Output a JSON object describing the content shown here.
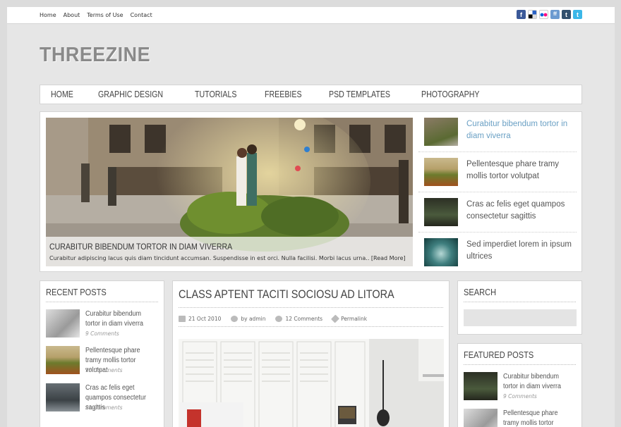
{
  "topbar": {
    "links": [
      "Home",
      "About",
      "Terms of Use",
      "Contact"
    ],
    "social_icons": [
      {
        "name": "facebook-icon",
        "color": "#3b5998",
        "glyph": "f"
      },
      {
        "name": "delicious-icon",
        "color": "#2a62c5",
        "glyph": ""
      },
      {
        "name": "flickr-icon",
        "color": "#ffffff",
        "glyph": ""
      },
      {
        "name": "friendfeed-icon",
        "color": "#6b9ad0",
        "glyph": "ff"
      },
      {
        "name": "tumblr-icon",
        "color": "#32506d",
        "glyph": "t"
      },
      {
        "name": "twitter-icon",
        "color": "#3bb7e8",
        "glyph": "t"
      }
    ]
  },
  "logo": "THREEZINE",
  "nav": [
    "HOME",
    "GRAPHIC DESIGN",
    "TUTORIALS",
    "FREEBIES",
    "PSD TEMPLATES",
    "PHOTOGRAPHY"
  ],
  "slider": {
    "caption_title": "CURABITUR BIBENDUM TORTOR IN DIAM VIVERRA",
    "caption_text": "Curabitur adipiscing lacus quis diam tincidunt accumsan. Suspendisse in est orci. Nulla facilisi. Morbi lacus urna.. [Read More]",
    "thumbs": [
      "Curabitur bibendum tortor in diam viverra",
      "Pellentesque phare tramy mollis tortor volutpat",
      "Cras ac felis eget quampos consectetur sagittis",
      "Sed imperdiet lorem in ipsum ultrices"
    ]
  },
  "recent_posts": {
    "title": "RECENT POSTS",
    "items": [
      {
        "title": "Curabitur bibendum tortor in diam viverra",
        "comments": "9 Comments"
      },
      {
        "title": "Pellentesque phare tramy mollis tortor volutpat",
        "comments": "13 Comments"
      },
      {
        "title": "Cras ac felis eget quampos consectetur sagittis",
        "comments": "21 Comments"
      }
    ]
  },
  "main_post": {
    "title": "CLASS APTENT TACITI SOCIOSU AD LITORA",
    "date": "21 Oct 2010",
    "author": "by admin",
    "comments": "12 Comments",
    "permalink": "Permalink"
  },
  "search": {
    "title": "SEARCH",
    "placeholder": ""
  },
  "featured_posts": {
    "title": "FEATURED POSTS",
    "items": [
      {
        "title": "Curabitur bibendum tortor in diam viverra",
        "comments": "9 Comments"
      },
      {
        "title": "Pellentesque phare tramy mollis tortor",
        "comments": ""
      }
    ]
  },
  "colors": {
    "accent_link": "#6aa0c4",
    "logo": "#8a8a8a",
    "background": "#e6e6e6"
  }
}
